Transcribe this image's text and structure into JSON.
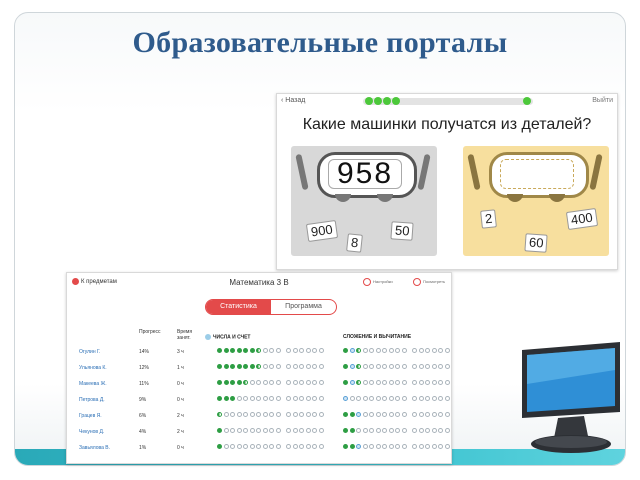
{
  "slide": {
    "title": "Образовательные порталы"
  },
  "app1": {
    "back_label": "Назад",
    "exit_label": "Выйти",
    "question": "Какие машинки получатся из деталей?",
    "progress": {
      "done": 4,
      "total": 5
    },
    "card_left": {
      "car_number": "958",
      "parts": [
        "900",
        "8",
        "50"
      ]
    },
    "card_right": {
      "car_number": "",
      "parts": [
        "2",
        "400",
        "60"
      ]
    }
  },
  "app2": {
    "back_label": "К предметам",
    "title": "Математика 3 В",
    "action1": "Настройки",
    "action2": "Посмотреть",
    "tabs": [
      "Статистика",
      "Программа"
    ],
    "active_tab": 0,
    "columns": {
      "progress": "Прогресс",
      "time": "Время",
      "time_sub": "занят."
    },
    "sections": [
      "ЧИСЛА И СЧЕТ",
      "СЛОЖЕНИЕ И ВЫЧИТАНИЕ"
    ],
    "students": [
      {
        "name": "Огулин Г.",
        "progress": "14%",
        "time": "3 ч"
      },
      {
        "name": "Ульянова К.",
        "progress": "12%",
        "time": "1 ч"
      },
      {
        "name": "Макеева Ж.",
        "progress": "11%",
        "time": "0 ч"
      },
      {
        "name": "Петрова Д.",
        "progress": "9%",
        "time": "0 ч"
      },
      {
        "name": "Грацев Я.",
        "progress": "6%",
        "time": "2 ч"
      },
      {
        "name": "Чекунов Д.",
        "progress": "4%",
        "time": "2 ч"
      },
      {
        "name": "Завьялова В.",
        "progress": "1%",
        "time": "0 ч"
      }
    ],
    "colors": {
      "accent": "#e34a4a",
      "done": "#2e9e44",
      "empty": "#aab4bb"
    }
  }
}
